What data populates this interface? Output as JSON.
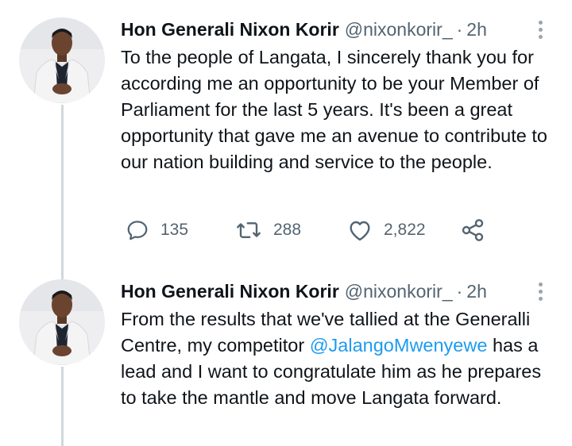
{
  "tweets": [
    {
      "author_name": "Hon Generali Nixon Korir",
      "handle": "@nixonkorir_",
      "separator": "·",
      "time": "2h",
      "text": "To the people of Langata, I sincerely thank you for according me an opportunity to be your Member of Parliament for the last 5 years. It's been a great opportunity that gave me an avenue to contribute to our nation building and service to the people.",
      "replies": "135",
      "retweets": "288",
      "likes": "2,822"
    },
    {
      "author_name": "Hon Generali Nixon Korir",
      "handle": "@nixonkorir_",
      "separator": "·",
      "time": "2h",
      "text_before": "From the results that we've tallied at the Generalli Centre, my competitor ",
      "mention": "@JalangoMwenyewe",
      "text_after": " has a lead and I want to congratulate him as he prepares to take the mantle and move Langata forward."
    }
  ],
  "icons": {
    "reply": "reply-icon",
    "retweet": "retweet-icon",
    "like": "heart-icon",
    "share": "share-icon",
    "more": "more-options-icon"
  },
  "colors": {
    "text": "#0f1419",
    "secondary": "#536471",
    "link": "#1d9bf0",
    "thread_line": "#cfd9de"
  }
}
